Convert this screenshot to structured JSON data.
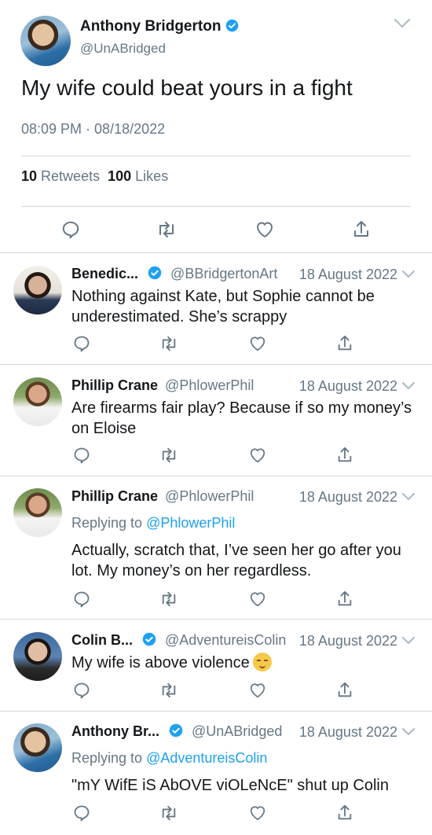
{
  "main_tweet": {
    "author_name": "Anthony Bridgerton",
    "handle": "@UnABridged",
    "text": "My wife could beat yours in a fight",
    "timestamp": "08:09 PM · 08/18/2022",
    "retweets_count": "10",
    "retweets_label": "Retweets",
    "likes_count": "100",
    "likes_label": "Likes"
  },
  "replies": [
    {
      "name": "Benedic...",
      "handle": "@BBridgertonArt",
      "date": "18 August 2022",
      "verified": true,
      "text": "Nothing against Kate, but Sophie cannot be underestimated. She’s scrappy"
    },
    {
      "name": "Phillip Crane",
      "handle": "@PhlowerPhil",
      "date": "18 August 2022",
      "verified": false,
      "text": "Are firearms fair play? Because if so my money’s on Eloise"
    },
    {
      "name": "Phillip Crane",
      "handle": "@PhlowerPhil",
      "date": "18 August 2022",
      "verified": false,
      "replying_prefix": "Replying to",
      "replying_to": "@PhlowerPhil",
      "text": "Actually, scratch that, I’ve seen her go after you lot. My money’s on her regardless."
    },
    {
      "name": "Colin B...",
      "handle": "@AdventureisColin",
      "date": "18 August 2022",
      "verified": true,
      "text": "My wife is above violence"
    },
    {
      "name": "Anthony Br...",
      "handle": "@UnABridged",
      "date": "18 August 2022",
      "verified": true,
      "replying_prefix": "Replying to",
      "replying_to": "@AdventureisColin",
      "text": "\"mY WifE iS AbOVE viOLeNcE\" shut up Colin"
    }
  ],
  "colors": {
    "accent": "#1da1f2",
    "secondary_text": "#657786",
    "primary_text": "#14171a",
    "divider": "#d4d9de"
  },
  "icons": {
    "reply": "speech-bubble",
    "retweet": "retweet-arrows",
    "like": "heart",
    "share": "share-upload",
    "verified": "verified-badge",
    "caret": "chevron-down"
  }
}
